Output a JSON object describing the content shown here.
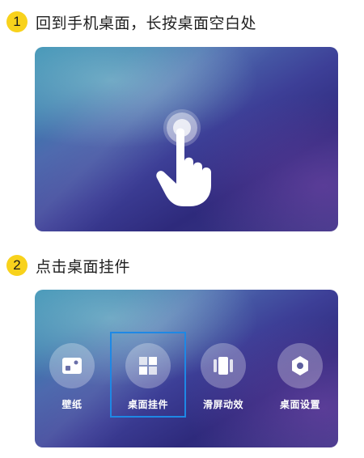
{
  "steps": [
    {
      "number": "1",
      "text": "回到手机桌面，长按桌面空白处"
    },
    {
      "number": "2",
      "text": "点击桌面挂件"
    }
  ],
  "desktop_menu": {
    "items": [
      {
        "label": "壁纸",
        "icon": "wallpaper-icon"
      },
      {
        "label": "桌面挂件",
        "icon": "widget-icon"
      },
      {
        "label": "滑屏动效",
        "icon": "swipe-effect-icon"
      },
      {
        "label": "桌面设置",
        "icon": "settings-hexagon-icon"
      }
    ],
    "highlighted_item": "桌面挂件"
  },
  "colors": {
    "step_badge": "#f8d21c",
    "highlight_border": "#1e88e5",
    "wallpaper_teal": "#3a8fb4",
    "wallpaper_indigo": "#2e2a7c"
  },
  "gesture": {
    "icon": "hand-press-icon",
    "action": "long-press"
  }
}
